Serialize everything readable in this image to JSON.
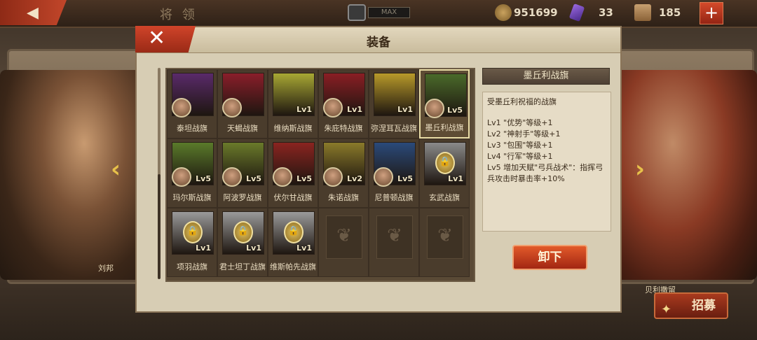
{
  "topbar": {
    "title": "将 领",
    "max_label": "MAX",
    "coins": "951699",
    "gems": "33",
    "scrolls": "185",
    "plus": "+"
  },
  "background": {
    "left_hero_name": "刘邦",
    "right_hero_name": "贝利撒留"
  },
  "modal": {
    "title": "装备",
    "close": "✕",
    "flags": [
      {
        "name": "泰坦战旗",
        "lv": "",
        "color": "#5a2a6a",
        "avatar": true,
        "locked": false
      },
      {
        "name": "天蝎战旗",
        "lv": "",
        "color": "#8a1e2a",
        "avatar": true,
        "locked": false
      },
      {
        "name": "维纳斯战旗",
        "lv": "Lv1",
        "color": "#a8a834",
        "avatar": false,
        "locked": false
      },
      {
        "name": "朱庇特战旗",
        "lv": "Lv1",
        "color": "#8a1e24",
        "avatar": true,
        "locked": false
      },
      {
        "name": "弥涅耳瓦战旗",
        "lv": "Lv1",
        "color": "#b89a2a",
        "avatar": false,
        "locked": false
      },
      {
        "name": "墨丘利战旗",
        "lv": "Lv5",
        "color": "#4a6a2a",
        "avatar": true,
        "locked": false,
        "selected": true
      },
      {
        "name": "玛尔斯战旗",
        "lv": "Lv5",
        "color": "#5a7a2a",
        "avatar": true,
        "locked": false
      },
      {
        "name": "阿波罗战旗",
        "lv": "Lv5",
        "color": "#6a7a2a",
        "avatar": true,
        "locked": false
      },
      {
        "name": "伏尔甘战旗",
        "lv": "Lv5",
        "color": "#8a2420",
        "avatar": true,
        "locked": false
      },
      {
        "name": "朱诺战旗",
        "lv": "Lv2",
        "color": "#8a7a2a",
        "avatar": true,
        "locked": false
      },
      {
        "name": "尼普顿战旗",
        "lv": "Lv5",
        "color": "#2a4a7a",
        "avatar": true,
        "locked": false
      },
      {
        "name": "玄武战旗",
        "lv": "Lv1",
        "color": "#8a8a8a",
        "avatar": false,
        "locked": true
      },
      {
        "name": "项羽战旗",
        "lv": "Lv1",
        "color": "#9a9a9a",
        "avatar": false,
        "locked": true
      },
      {
        "name": "君士坦丁战旗",
        "lv": "Lv1",
        "color": "#9a9a9a",
        "avatar": false,
        "locked": true
      },
      {
        "name": "维斯帕先战旗",
        "lv": "Lv1",
        "color": "#9a9a9a",
        "avatar": false,
        "locked": true
      }
    ],
    "detail": {
      "title": "墨丘利战旗",
      "desc": "受墨丘利祝福的战旗",
      "lv1": "Lv1 \"优势\"等级+1",
      "lv2": "Lv2 \"神射手\"等级+1",
      "lv3": "Lv3 \"包围\"等级+1",
      "lv4": "Lv4 \"行军\"等级+1",
      "lv5": "Lv5 增加天赋\"弓兵战术\"：指挥弓兵攻击时暴击率+10%"
    },
    "unequip_label": "卸下"
  },
  "recruit_label": "招募"
}
